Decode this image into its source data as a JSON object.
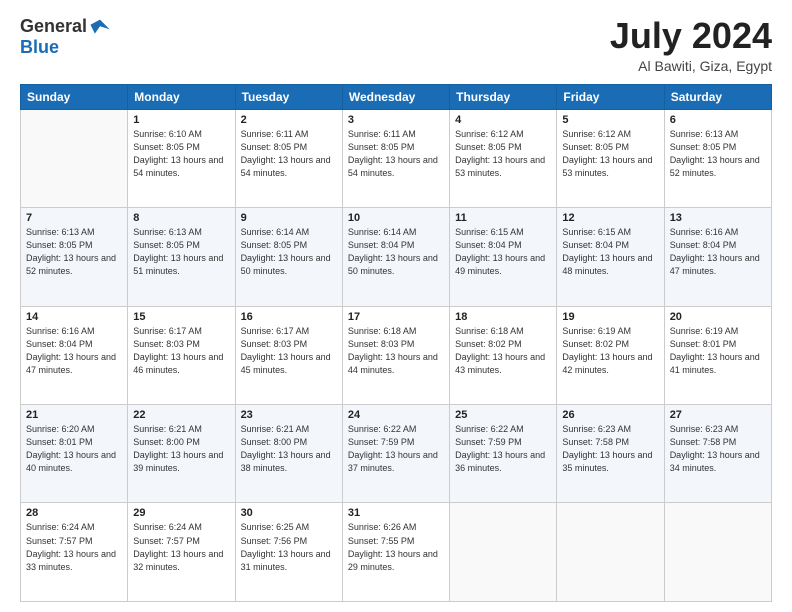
{
  "header": {
    "logo_general": "General",
    "logo_blue": "Blue",
    "month_title": "July 2024",
    "location": "Al Bawiti, Giza, Egypt"
  },
  "days": [
    "Sunday",
    "Monday",
    "Tuesday",
    "Wednesday",
    "Thursday",
    "Friday",
    "Saturday"
  ],
  "weeks": [
    [
      {
        "date": "",
        "sunrise": "",
        "sunset": "",
        "daylight": ""
      },
      {
        "date": "1",
        "sunrise": "Sunrise: 6:10 AM",
        "sunset": "Sunset: 8:05 PM",
        "daylight": "Daylight: 13 hours and 54 minutes."
      },
      {
        "date": "2",
        "sunrise": "Sunrise: 6:11 AM",
        "sunset": "Sunset: 8:05 PM",
        "daylight": "Daylight: 13 hours and 54 minutes."
      },
      {
        "date": "3",
        "sunrise": "Sunrise: 6:11 AM",
        "sunset": "Sunset: 8:05 PM",
        "daylight": "Daylight: 13 hours and 54 minutes."
      },
      {
        "date": "4",
        "sunrise": "Sunrise: 6:12 AM",
        "sunset": "Sunset: 8:05 PM",
        "daylight": "Daylight: 13 hours and 53 minutes."
      },
      {
        "date": "5",
        "sunrise": "Sunrise: 6:12 AM",
        "sunset": "Sunset: 8:05 PM",
        "daylight": "Daylight: 13 hours and 53 minutes."
      },
      {
        "date": "6",
        "sunrise": "Sunrise: 6:13 AM",
        "sunset": "Sunset: 8:05 PM",
        "daylight": "Daylight: 13 hours and 52 minutes."
      }
    ],
    [
      {
        "date": "7",
        "sunrise": "Sunrise: 6:13 AM",
        "sunset": "Sunset: 8:05 PM",
        "daylight": "Daylight: 13 hours and 52 minutes."
      },
      {
        "date": "8",
        "sunrise": "Sunrise: 6:13 AM",
        "sunset": "Sunset: 8:05 PM",
        "daylight": "Daylight: 13 hours and 51 minutes."
      },
      {
        "date": "9",
        "sunrise": "Sunrise: 6:14 AM",
        "sunset": "Sunset: 8:05 PM",
        "daylight": "Daylight: 13 hours and 50 minutes."
      },
      {
        "date": "10",
        "sunrise": "Sunrise: 6:14 AM",
        "sunset": "Sunset: 8:04 PM",
        "daylight": "Daylight: 13 hours and 50 minutes."
      },
      {
        "date": "11",
        "sunrise": "Sunrise: 6:15 AM",
        "sunset": "Sunset: 8:04 PM",
        "daylight": "Daylight: 13 hours and 49 minutes."
      },
      {
        "date": "12",
        "sunrise": "Sunrise: 6:15 AM",
        "sunset": "Sunset: 8:04 PM",
        "daylight": "Daylight: 13 hours and 48 minutes."
      },
      {
        "date": "13",
        "sunrise": "Sunrise: 6:16 AM",
        "sunset": "Sunset: 8:04 PM",
        "daylight": "Daylight: 13 hours and 47 minutes."
      }
    ],
    [
      {
        "date": "14",
        "sunrise": "Sunrise: 6:16 AM",
        "sunset": "Sunset: 8:04 PM",
        "daylight": "Daylight: 13 hours and 47 minutes."
      },
      {
        "date": "15",
        "sunrise": "Sunrise: 6:17 AM",
        "sunset": "Sunset: 8:03 PM",
        "daylight": "Daylight: 13 hours and 46 minutes."
      },
      {
        "date": "16",
        "sunrise": "Sunrise: 6:17 AM",
        "sunset": "Sunset: 8:03 PM",
        "daylight": "Daylight: 13 hours and 45 minutes."
      },
      {
        "date": "17",
        "sunrise": "Sunrise: 6:18 AM",
        "sunset": "Sunset: 8:03 PM",
        "daylight": "Daylight: 13 hours and 44 minutes."
      },
      {
        "date": "18",
        "sunrise": "Sunrise: 6:18 AM",
        "sunset": "Sunset: 8:02 PM",
        "daylight": "Daylight: 13 hours and 43 minutes."
      },
      {
        "date": "19",
        "sunrise": "Sunrise: 6:19 AM",
        "sunset": "Sunset: 8:02 PM",
        "daylight": "Daylight: 13 hours and 42 minutes."
      },
      {
        "date": "20",
        "sunrise": "Sunrise: 6:19 AM",
        "sunset": "Sunset: 8:01 PM",
        "daylight": "Daylight: 13 hours and 41 minutes."
      }
    ],
    [
      {
        "date": "21",
        "sunrise": "Sunrise: 6:20 AM",
        "sunset": "Sunset: 8:01 PM",
        "daylight": "Daylight: 13 hours and 40 minutes."
      },
      {
        "date": "22",
        "sunrise": "Sunrise: 6:21 AM",
        "sunset": "Sunset: 8:00 PM",
        "daylight": "Daylight: 13 hours and 39 minutes."
      },
      {
        "date": "23",
        "sunrise": "Sunrise: 6:21 AM",
        "sunset": "Sunset: 8:00 PM",
        "daylight": "Daylight: 13 hours and 38 minutes."
      },
      {
        "date": "24",
        "sunrise": "Sunrise: 6:22 AM",
        "sunset": "Sunset: 7:59 PM",
        "daylight": "Daylight: 13 hours and 37 minutes."
      },
      {
        "date": "25",
        "sunrise": "Sunrise: 6:22 AM",
        "sunset": "Sunset: 7:59 PM",
        "daylight": "Daylight: 13 hours and 36 minutes."
      },
      {
        "date": "26",
        "sunrise": "Sunrise: 6:23 AM",
        "sunset": "Sunset: 7:58 PM",
        "daylight": "Daylight: 13 hours and 35 minutes."
      },
      {
        "date": "27",
        "sunrise": "Sunrise: 6:23 AM",
        "sunset": "Sunset: 7:58 PM",
        "daylight": "Daylight: 13 hours and 34 minutes."
      }
    ],
    [
      {
        "date": "28",
        "sunrise": "Sunrise: 6:24 AM",
        "sunset": "Sunset: 7:57 PM",
        "daylight": "Daylight: 13 hours and 33 minutes."
      },
      {
        "date": "29",
        "sunrise": "Sunrise: 6:24 AM",
        "sunset": "Sunset: 7:57 PM",
        "daylight": "Daylight: 13 hours and 32 minutes."
      },
      {
        "date": "30",
        "sunrise": "Sunrise: 6:25 AM",
        "sunset": "Sunset: 7:56 PM",
        "daylight": "Daylight: 13 hours and 31 minutes."
      },
      {
        "date": "31",
        "sunrise": "Sunrise: 6:26 AM",
        "sunset": "Sunset: 7:55 PM",
        "daylight": "Daylight: 13 hours and 29 minutes."
      },
      {
        "date": "",
        "sunrise": "",
        "sunset": "",
        "daylight": ""
      },
      {
        "date": "",
        "sunrise": "",
        "sunset": "",
        "daylight": ""
      },
      {
        "date": "",
        "sunrise": "",
        "sunset": "",
        "daylight": ""
      }
    ]
  ]
}
